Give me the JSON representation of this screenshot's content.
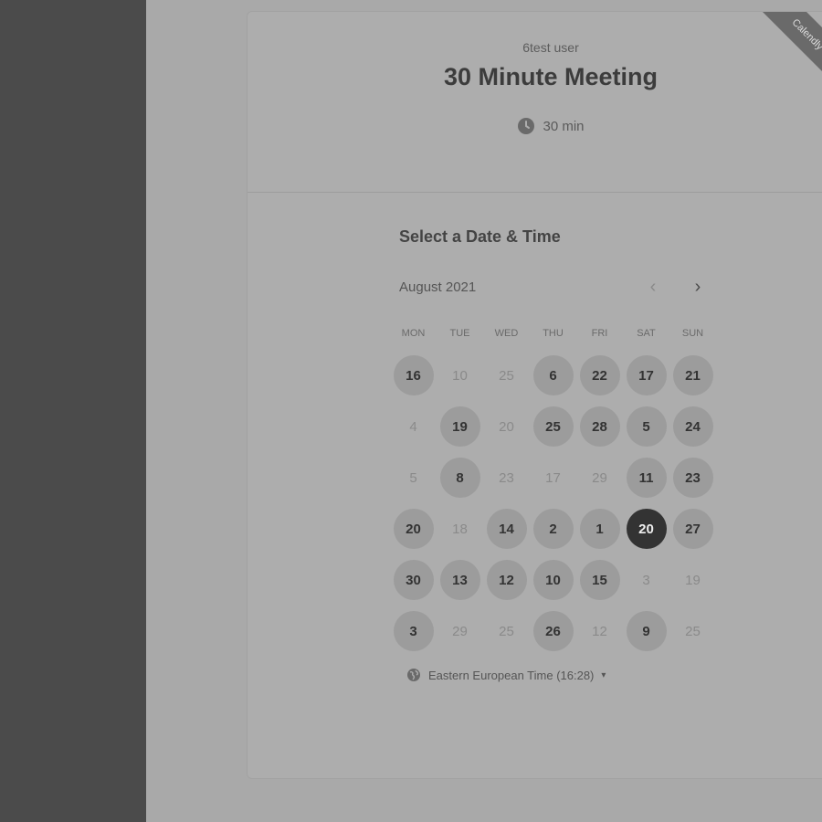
{
  "event": {
    "owner": "6test user",
    "title": "30 Minute Meeting",
    "duration": "30 min",
    "ribbon": "Calendly"
  },
  "scheduler": {
    "heading": "Select a Date & Time",
    "month": "August 2021",
    "prev_label": "‹",
    "next_label": "›",
    "weekdays": [
      "MON",
      "TUE",
      "WED",
      "THU",
      "FRI",
      "SAT",
      "SUN"
    ],
    "weeks": [
      [
        {
          "d": "16",
          "a": true
        },
        {
          "d": "10",
          "a": false
        },
        {
          "d": "25",
          "a": false
        },
        {
          "d": "6",
          "a": true
        },
        {
          "d": "22",
          "a": true
        },
        {
          "d": "17",
          "a": true
        },
        {
          "d": "21",
          "a": true
        }
      ],
      [
        {
          "d": "4",
          "a": false
        },
        {
          "d": "19",
          "a": true
        },
        {
          "d": "20",
          "a": false
        },
        {
          "d": "25",
          "a": true
        },
        {
          "d": "28",
          "a": true
        },
        {
          "d": "5",
          "a": true
        },
        {
          "d": "24",
          "a": true
        }
      ],
      [
        {
          "d": "5",
          "a": false
        },
        {
          "d": "8",
          "a": true
        },
        {
          "d": "23",
          "a": false
        },
        {
          "d": "17",
          "a": false
        },
        {
          "d": "29",
          "a": false
        },
        {
          "d": "11",
          "a": true
        },
        {
          "d": "23",
          "a": true
        }
      ],
      [
        {
          "d": "20",
          "a": true
        },
        {
          "d": "18",
          "a": false
        },
        {
          "d": "14",
          "a": true
        },
        {
          "d": "2",
          "a": true
        },
        {
          "d": "1",
          "a": true
        },
        {
          "d": "20",
          "a": true,
          "selected": true
        },
        {
          "d": "27",
          "a": true
        }
      ],
      [
        {
          "d": "30",
          "a": true
        },
        {
          "d": "13",
          "a": true
        },
        {
          "d": "12",
          "a": true
        },
        {
          "d": "10",
          "a": true
        },
        {
          "d": "15",
          "a": true
        },
        {
          "d": "3",
          "a": false
        },
        {
          "d": "19",
          "a": false
        }
      ],
      [
        {
          "d": "3",
          "a": true
        },
        {
          "d": "29",
          "a": false
        },
        {
          "d": "25",
          "a": false
        },
        {
          "d": "26",
          "a": true
        },
        {
          "d": "12",
          "a": false
        },
        {
          "d": "9",
          "a": true
        },
        {
          "d": "25",
          "a": false
        }
      ]
    ],
    "timezone": "Eastern European Time (16:28)",
    "timezone_caret": "▾"
  },
  "icons": {
    "clock": "clock-icon",
    "globe": "globe-icon"
  }
}
